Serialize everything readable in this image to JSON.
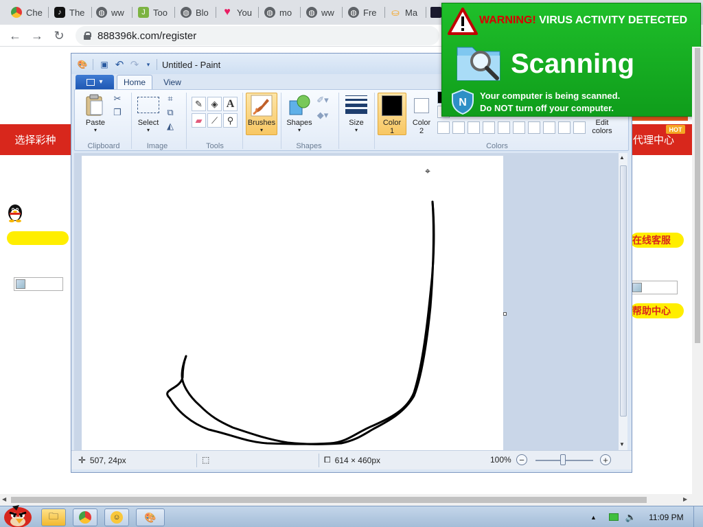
{
  "browser": {
    "tabs": [
      {
        "label": "Che",
        "icon": "chrome-icon",
        "color": "#e53935"
      },
      {
        "label": "The",
        "icon": "tiktok-icon",
        "color": "#111111"
      },
      {
        "label": "ww",
        "icon": "globe-icon",
        "color": "#5f6368"
      },
      {
        "label": "Too",
        "icon": "bookmark-icon",
        "color": "#7cb342"
      },
      {
        "label": "Blo",
        "icon": "globe-icon",
        "color": "#5f6368"
      },
      {
        "label": "You",
        "icon": "heart-icon",
        "color": "#e91e63"
      },
      {
        "label": "mo",
        "icon": "globe-icon",
        "color": "#5f6368"
      },
      {
        "label": "ww",
        "icon": "globe-icon",
        "color": "#5f6368"
      },
      {
        "label": "Fre",
        "icon": "globe-icon",
        "color": "#5f6368"
      },
      {
        "label": "Ma",
        "icon": "box-icon",
        "color": "#f5a623"
      }
    ],
    "url": "888396k.com/register"
  },
  "site": {
    "left_nav": "选择彩种",
    "right_nav": "代理中心",
    "hot_badge": "HOT",
    "online_service": "在线客服",
    "help_center": "帮助中心"
  },
  "paint": {
    "title": "Untitled - Paint",
    "tabs": {
      "home": "Home",
      "view": "View"
    },
    "groups": {
      "clipboard": "Clipboard",
      "image": "Image",
      "tools": "Tools",
      "shapes": "Shapes",
      "colors": "Colors"
    },
    "buttons": {
      "paste": "Paste",
      "select": "Select",
      "brushes": "Brushes",
      "shapes": "Shapes",
      "size": "Size",
      "color1": "Color\n1",
      "color1_a": "Color",
      "color1_b": "1",
      "color2_a": "Color",
      "color2_b": "2",
      "edit_colors_a": "Edit",
      "edit_colors_b": "colors"
    },
    "color1": "#000000",
    "color2": "#ffffff",
    "status": {
      "cursor_pos": "507, 24px",
      "canvas_size": "614 × 460px",
      "zoom": "100%"
    }
  },
  "popup": {
    "warning_prefix": "WARNING!",
    "warning_text": " VIRUS ACTIVITY DETECTED",
    "headline": "Scanning",
    "line1": "Your computer is being scanned.",
    "line2_a": "Do ",
    "line2_b": "NOT",
    "line2_c": " turn off your computer.",
    "bg_color": "#16b023"
  },
  "taskbar": {
    "clock": "11:09 PM"
  }
}
